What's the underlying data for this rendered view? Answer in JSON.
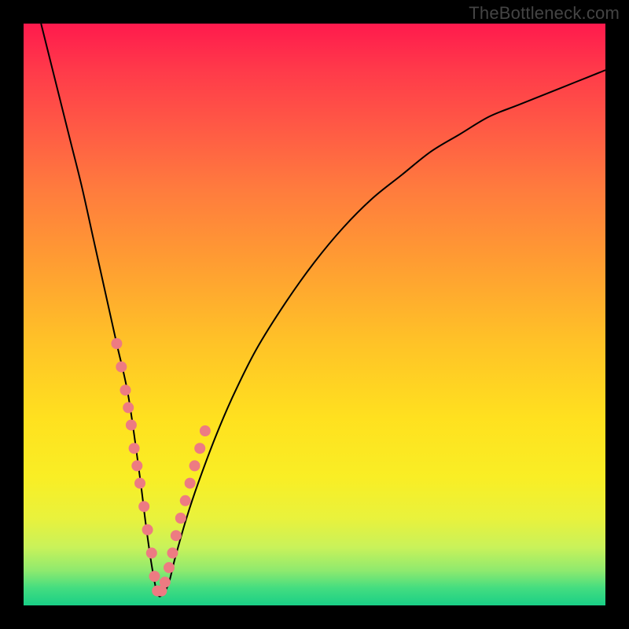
{
  "watermark": "TheBottleneck.com",
  "colors": {
    "background_frame": "#000000",
    "curve_stroke": "#000000",
    "dot_fill": "#ed7b82",
    "gradient_top": "#ff1a4d",
    "gradient_bottom": "#19cf86"
  },
  "chart_data": {
    "type": "line",
    "title": "",
    "xlabel": "",
    "ylabel": "",
    "xlim": [
      0,
      100
    ],
    "ylim": [
      0,
      100
    ],
    "note": "V-shaped bottleneck curve; y≈0 is optimal (green). Minimum near x≈23. Values estimated from plot pixels.",
    "x": [
      3,
      5,
      8,
      10,
      12,
      14,
      16,
      18,
      20,
      21,
      22,
      23,
      24,
      25,
      26,
      28,
      30,
      33,
      36,
      40,
      45,
      50,
      55,
      60,
      65,
      70,
      75,
      80,
      85,
      90,
      95,
      100
    ],
    "values": [
      100,
      92,
      80,
      72,
      63,
      54,
      45,
      36,
      22,
      14,
      7,
      2,
      2,
      4,
      8,
      15,
      21,
      29,
      36,
      44,
      52,
      59,
      65,
      70,
      74,
      78,
      81,
      84,
      86,
      88,
      90,
      92
    ],
    "highlight_dots": {
      "note": "Salmon dots clustered on both flanks of the V near the minimum (estimated).",
      "points_xy": [
        [
          16,
          45
        ],
        [
          16.8,
          41
        ],
        [
          17.5,
          37
        ],
        [
          18,
          34
        ],
        [
          18.5,
          31
        ],
        [
          19,
          27
        ],
        [
          19.5,
          24
        ],
        [
          20,
          21
        ],
        [
          20.7,
          17
        ],
        [
          21.3,
          13
        ],
        [
          22,
          9
        ],
        [
          22.5,
          5
        ],
        [
          23,
          2.5
        ],
        [
          23.7,
          2.5
        ],
        [
          24.3,
          4
        ],
        [
          25,
          6.5
        ],
        [
          25.6,
          9
        ],
        [
          26.2,
          12
        ],
        [
          27,
          15
        ],
        [
          27.8,
          18
        ],
        [
          28.6,
          21
        ],
        [
          29.4,
          24
        ],
        [
          30.3,
          27
        ],
        [
          31.2,
          30
        ]
      ]
    }
  }
}
